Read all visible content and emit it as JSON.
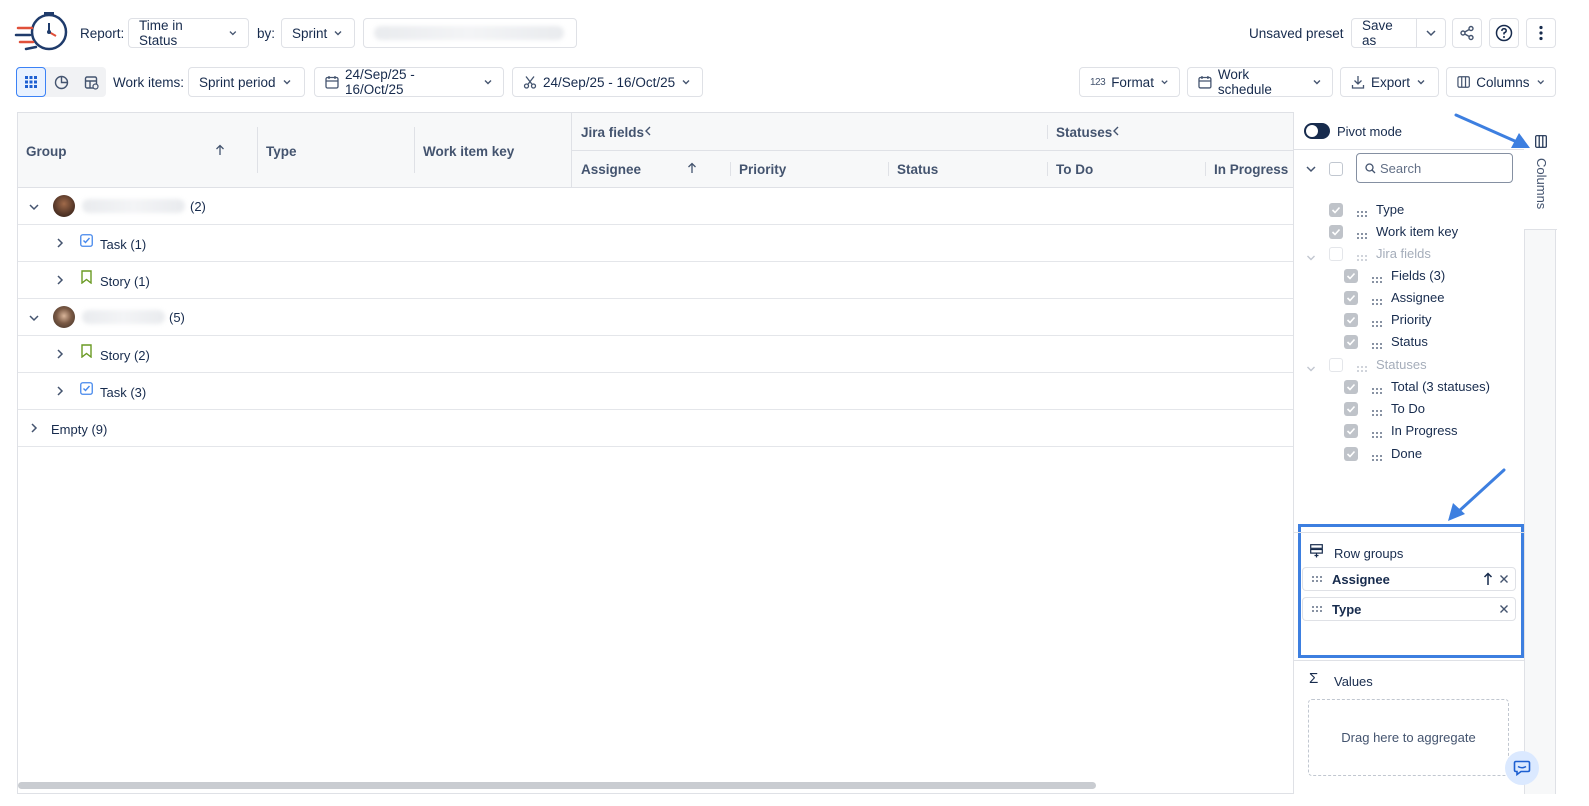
{
  "header": {
    "report_label": "Report:",
    "report_value": "Time in Status",
    "by_label": "by:",
    "by_value": "Sprint",
    "preset_status": "Unsaved preset",
    "save_as_label": "Save as"
  },
  "toolbar": {
    "work_items_label": "Work items:",
    "work_items_value": "Sprint period",
    "date_range_1": "24/Sep/25 - 16/Oct/25",
    "date_range_2": "24/Sep/25 - 16/Oct/25",
    "format_label": "Format",
    "work_schedule_label": "Work schedule",
    "export_label": "Export",
    "columns_label": "Columns"
  },
  "grid": {
    "headers": {
      "group": "Group",
      "type": "Type",
      "work_item_key": "Work item key",
      "jira_fields": "Jira fields",
      "statuses": "Statuses",
      "assignee": "Assignee",
      "priority": "Priority",
      "status": "Status",
      "to_do": "To Do",
      "in_progress": "In Progress"
    },
    "rows": [
      {
        "label": "(2)"
      },
      {
        "label": "Task (1)"
      },
      {
        "label": "Story (1)"
      },
      {
        "label": "(5)"
      },
      {
        "label": "Story (2)"
      },
      {
        "label": "Task (3)"
      },
      {
        "label": "Empty (9)"
      }
    ]
  },
  "panel": {
    "pivot_mode_label": "Pivot mode",
    "search_placeholder": "Search",
    "columns": [
      {
        "label": "Type"
      },
      {
        "label": "Work item key"
      },
      {
        "label": "Jira fields"
      },
      {
        "label": "Fields (3)"
      },
      {
        "label": "Assignee"
      },
      {
        "label": "Priority"
      },
      {
        "label": "Status"
      },
      {
        "label": "Statuses"
      },
      {
        "label": "Total (3 statuses)"
      },
      {
        "label": "To Do"
      },
      {
        "label": "In Progress"
      },
      {
        "label": "Done"
      }
    ],
    "row_groups_label": "Row groups",
    "row_groups": [
      {
        "label": "Assignee"
      },
      {
        "label": "Type"
      }
    ],
    "values_label": "Values",
    "values_drop_hint": "Drag here to aggregate"
  },
  "side_tab_label": "Columns",
  "colors": {
    "accent": "#3b82f6",
    "highlight_box": "#3d7fe0",
    "story_green": "#6a9a23",
    "task_blue": "#4688ec"
  }
}
